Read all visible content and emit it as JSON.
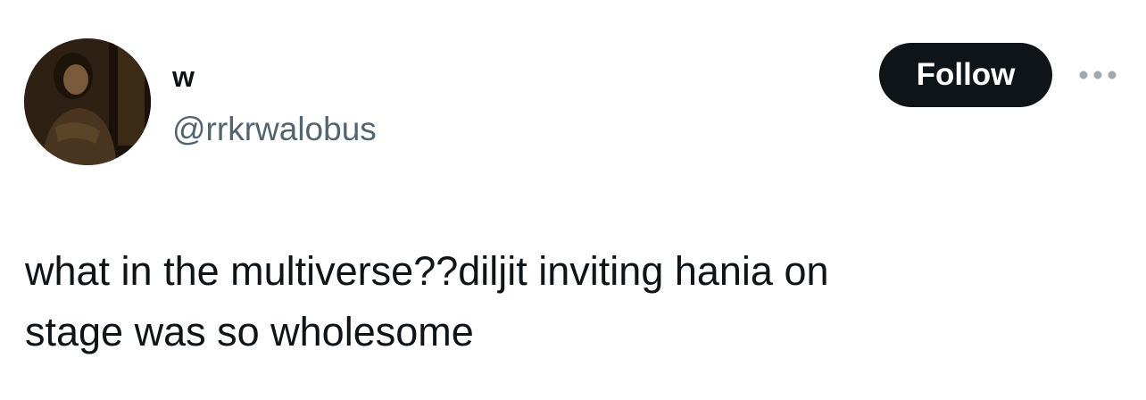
{
  "tweet": {
    "author": {
      "display_name": "w",
      "handle": "@rrkrwalobus",
      "avatar_icon": "profile-photo"
    },
    "follow_label": "Follow",
    "more_icon": "more-horizontal-icon",
    "text": "what in the multiverse??diljit inviting hania on\nstage was so wholesome"
  },
  "colors": {
    "text_primary": "#0f1419",
    "text_secondary": "#536471",
    "follow_bg": "#0f1419",
    "follow_text": "#ffffff",
    "icon_muted": "#a0a8b0"
  }
}
